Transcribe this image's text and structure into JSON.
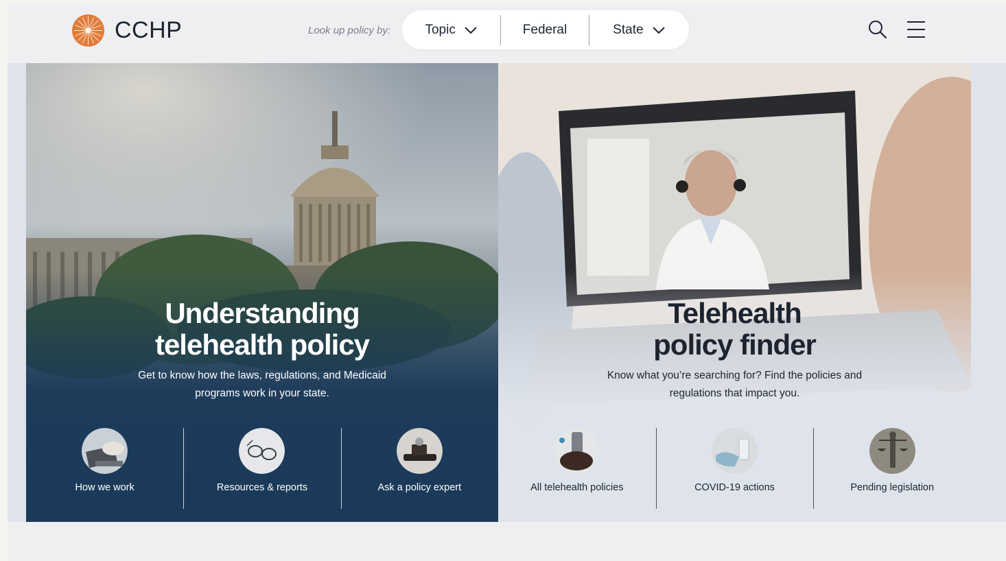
{
  "brand": {
    "name": "CCHP",
    "accent": "#e07b39"
  },
  "header": {
    "lookup_label": "Look up policy by:",
    "nav": [
      {
        "label": "Topic",
        "has_dropdown": true
      },
      {
        "label": "Federal",
        "has_dropdown": false
      },
      {
        "label": "State",
        "has_dropdown": true
      }
    ],
    "icons": [
      "search-icon",
      "hamburger-menu-icon"
    ]
  },
  "hero_left": {
    "title_line1": "Understanding",
    "title_line2": "telehealth policy",
    "subtitle_line1": "Get to know how the laws, regulations, and Medicaid",
    "subtitle_line2": "programs work in your state.",
    "background_color": "#1b3a59",
    "links": [
      {
        "label": "How we work",
        "icon": "laptop-photo"
      },
      {
        "label": "Resources & reports",
        "icon": "glasses-photo"
      },
      {
        "label": "Ask a policy expert",
        "icon": "stethoscope-photo"
      }
    ]
  },
  "hero_right": {
    "title_line1": "Telehealth",
    "title_line2": "policy finder",
    "subtitle_line1": "Know what you’re searching for? Find the policies and",
    "subtitle_line2": "regulations that impact you.",
    "background_color": "#dfe4ec",
    "links": [
      {
        "label": "All telehealth policies",
        "icon": "phone-hands-photo"
      },
      {
        "label": "COVID-19 actions",
        "icon": "mask-photo"
      },
      {
        "label": "Pending legislation",
        "icon": "justice-statue-photo"
      }
    ]
  }
}
